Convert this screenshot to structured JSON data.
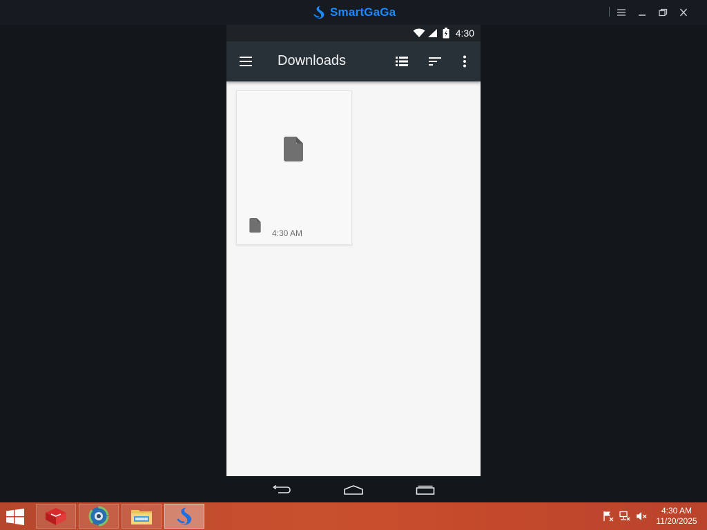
{
  "emulator": {
    "brand": "SmartGaGa",
    "controls": [
      "menu-icon",
      "minimize-icon",
      "restore-icon",
      "close-icon"
    ]
  },
  "android": {
    "status_bar": {
      "time": "4:30",
      "icons": [
        "wifi-icon",
        "signal-icon",
        "battery-icon"
      ]
    },
    "app_bar": {
      "title": "Downloads",
      "actions": [
        "hamburger-menu-icon",
        "list-view-icon",
        "sort-icon",
        "more-options-icon"
      ]
    },
    "files": [
      {
        "time": "4:30 AM",
        "icon": "file-icon"
      }
    ],
    "nav_bar": [
      "back-icon",
      "home-icon",
      "recents-icon"
    ]
  },
  "taskbar": {
    "apps": [
      "app-red-box-icon",
      "browser-globe-icon",
      "file-explorer-icon",
      "smartgaga-icon"
    ],
    "tray": [
      "action-center-flag-icon",
      "network-icon",
      "volume-muted-icon"
    ],
    "clock_time": "4:30 AM",
    "clock_date": "11/20/2025"
  },
  "colors": {
    "brand": "#1e88ff",
    "app_bar": "#283038",
    "taskbar": "#c9502e"
  }
}
